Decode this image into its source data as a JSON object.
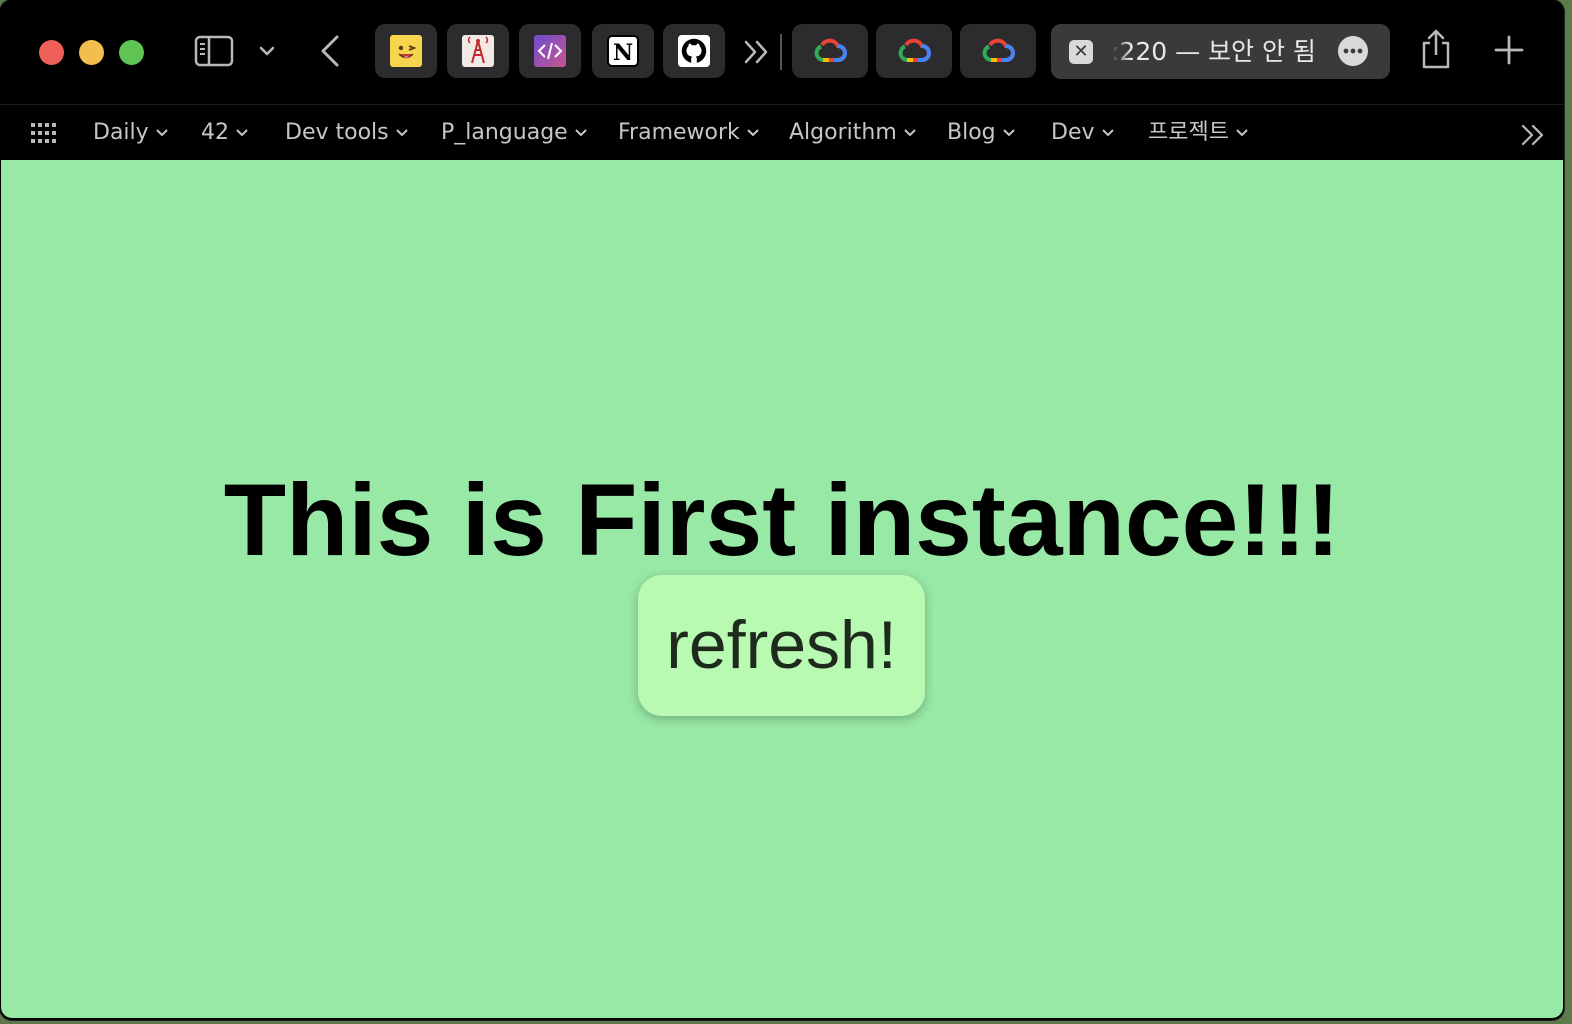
{
  "window": {
    "traffic_lights": [
      "close",
      "minimize",
      "zoom"
    ]
  },
  "toolbar": {
    "icons": {
      "sidebar": "sidebar-icon",
      "sidebar_menu": "chevron-down-icon",
      "back": "chevron-left-icon",
      "more_tabs": "double-chevron-right-icon",
      "share": "share-icon",
      "new_tab": "plus-icon"
    }
  },
  "pinned_tabs": [
    {
      "icon": "emoji-face-icon",
      "glyph": "😜"
    },
    {
      "icon": "tower-icon",
      "glyph": "A"
    },
    {
      "icon": "code-icon",
      "glyph": "</>"
    },
    {
      "icon": "notion-icon",
      "glyph": "N"
    },
    {
      "icon": "github-icon",
      "glyph": ""
    }
  ],
  "cloud_tabs": [
    {
      "icon": "google-cloud-icon"
    },
    {
      "icon": "google-cloud-icon"
    },
    {
      "icon": "google-cloud-icon"
    }
  ],
  "active_tab": {
    "title": ":220 — 보안 안 됨",
    "close_glyph": "✕"
  },
  "bookmarks": [
    {
      "label": "Daily"
    },
    {
      "label": "42"
    },
    {
      "label": "Dev tools"
    },
    {
      "label": "P_language"
    },
    {
      "label": "Framework"
    },
    {
      "label": "Algorithm"
    },
    {
      "label": "Blog"
    },
    {
      "label": "Dev"
    },
    {
      "label": "프로젝트"
    }
  ],
  "page": {
    "background": "#98e8a6",
    "headline": "This is First instance!!!",
    "refresh_button": {
      "label": "refresh!",
      "background": "#b8fab2"
    }
  }
}
